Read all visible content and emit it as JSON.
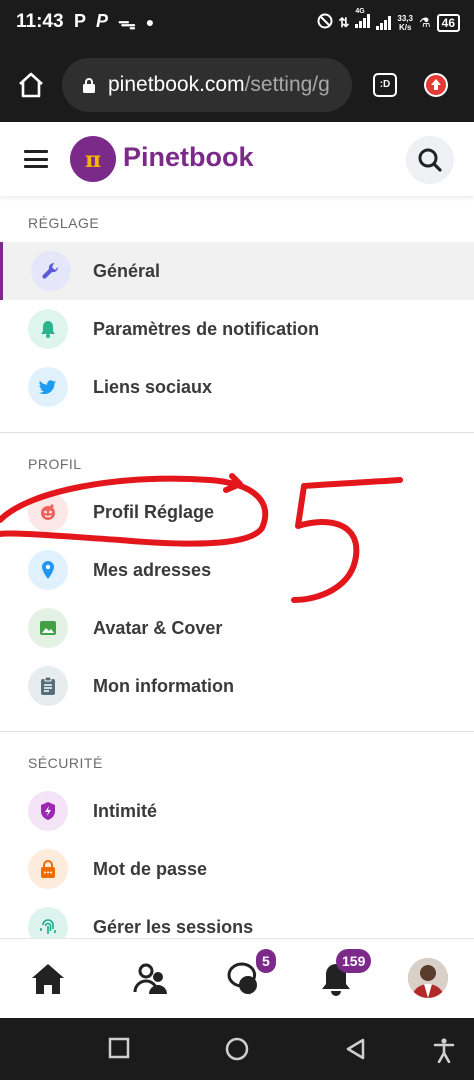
{
  "status_bar": {
    "time": "11:43",
    "net_gen": "4G",
    "net_speed_value": "33,3",
    "net_speed_unit": "K/s",
    "battery": "46"
  },
  "browser": {
    "url_host": "pinetbook.com",
    "url_path": "/setting/g",
    "tabs_label": ":D"
  },
  "header": {
    "logo_text": "Pinetbook"
  },
  "sections": {
    "reglage": {
      "title": "RÉGLAGE",
      "items": [
        {
          "label": "Général",
          "icon": "wrench-icon",
          "color": "#5b5bd6"
        },
        {
          "label": "Paramètres de notification",
          "icon": "bell-icon",
          "color": "#2bb58f"
        },
        {
          "label": "Liens sociaux",
          "icon": "twitter-icon",
          "color": "#1d9bf0"
        }
      ]
    },
    "profil": {
      "title": "PROFIL",
      "items": [
        {
          "label": "Profil Réglage",
          "icon": "profile-face-icon",
          "color": "#f0625e"
        },
        {
          "label": "Mes adresses",
          "icon": "location-pin-icon",
          "color": "#2196f3"
        },
        {
          "label": "Avatar & Cover",
          "icon": "image-icon",
          "color": "#43a047"
        },
        {
          "label": "Mon information",
          "icon": "clipboard-icon",
          "color": "#546e7a"
        }
      ]
    },
    "securite": {
      "title": "SÉCURITÉ",
      "items": [
        {
          "label": "Intimité",
          "icon": "shield-bolt-icon",
          "color": "#9c27b0"
        },
        {
          "label": "Mot de passe",
          "icon": "lock-icon",
          "color": "#ef6c00"
        },
        {
          "label": "Gérer les sessions",
          "icon": "fingerprint-icon",
          "color": "#1fa88c"
        }
      ]
    }
  },
  "bottom_nav": {
    "messages_badge": "5",
    "notifications_badge": "159"
  },
  "annotation": {
    "number": "5",
    "color": "#e3161c"
  }
}
